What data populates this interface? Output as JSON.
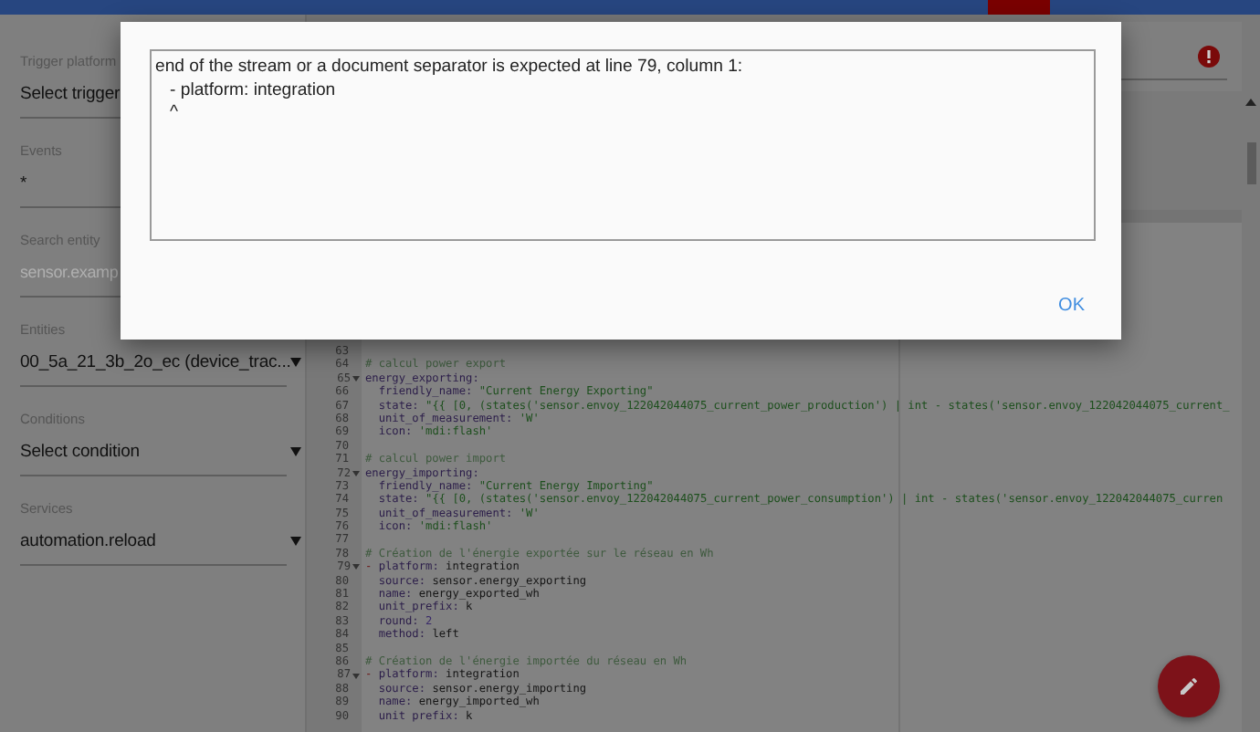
{
  "sidebar": {
    "fields": [
      {
        "label": "Trigger platform",
        "value": "Select trigger",
        "kind": "text"
      },
      {
        "label": "Events",
        "value": "*",
        "kind": "text"
      },
      {
        "label": "Search entity",
        "placeholder": "sensor.examp",
        "kind": "text"
      },
      {
        "label": "Entities",
        "value": "00_5a_21_3b_2o_ec (device_trac...",
        "kind": "dropdown"
      },
      {
        "label": "Conditions",
        "value": "Select condition",
        "kind": "dropdown"
      },
      {
        "label": "Services",
        "value": "automation.reload",
        "kind": "dropdown"
      }
    ]
  },
  "editor": {
    "lines": [
      {
        "number": "63",
        "fold": false
      },
      {
        "number": "64",
        "fold": false,
        "parts": [
          {
            "kind": "comment",
            "text": "# calcul power export"
          }
        ]
      },
      {
        "number": "65",
        "fold": true,
        "parts": [
          {
            "kind": "key",
            "text": "energy_exporting:"
          }
        ]
      },
      {
        "number": "66",
        "fold": false,
        "parts": [
          {
            "kind": "key",
            "text": "  friendly_name: "
          },
          {
            "kind": "string",
            "text": "\"Current Energy Exporting\""
          }
        ]
      },
      {
        "number": "67",
        "fold": false,
        "parts": [
          {
            "kind": "key",
            "text": "  state: "
          },
          {
            "kind": "string",
            "text": "\"{{ [0, (states('sensor.envoy_122042044075_current_power_production') | int - states('sensor.envoy_122042044075_current_"
          }
        ]
      },
      {
        "number": "68",
        "fold": false,
        "parts": [
          {
            "kind": "key",
            "text": "  unit_of_measurement: "
          },
          {
            "kind": "string",
            "text": "'W'"
          }
        ]
      },
      {
        "number": "69",
        "fold": false,
        "parts": [
          {
            "kind": "key",
            "text": "  icon: "
          },
          {
            "kind": "string",
            "text": "'mdi:flash'"
          }
        ]
      },
      {
        "number": "70",
        "fold": false
      },
      {
        "number": "71",
        "fold": false,
        "parts": [
          {
            "kind": "comment",
            "text": "# calcul power import"
          }
        ]
      },
      {
        "number": "72",
        "fold": true,
        "parts": [
          {
            "kind": "key",
            "text": "energy_importing:"
          }
        ]
      },
      {
        "number": "73",
        "fold": false,
        "parts": [
          {
            "kind": "key",
            "text": "  friendly_name: "
          },
          {
            "kind": "string",
            "text": "\"Current Energy Importing\""
          }
        ]
      },
      {
        "number": "74",
        "fold": false,
        "parts": [
          {
            "kind": "key",
            "text": "  state: "
          },
          {
            "kind": "string",
            "text": "\"{{ [0, (states('sensor.envoy_122042044075_current_power_consumption') | int - states('sensor.envoy_122042044075_curren"
          }
        ]
      },
      {
        "number": "75",
        "fold": false,
        "parts": [
          {
            "kind": "key",
            "text": "  unit_of_measurement: "
          },
          {
            "kind": "string",
            "text": "'W'"
          }
        ]
      },
      {
        "number": "76",
        "fold": false,
        "parts": [
          {
            "kind": "key",
            "text": "  icon: "
          },
          {
            "kind": "string",
            "text": "'mdi:flash'"
          }
        ]
      },
      {
        "number": "77",
        "fold": false
      },
      {
        "number": "78",
        "fold": false,
        "parts": [
          {
            "kind": "comment",
            "text": "# Création de l'énergie exportée sur le réseau en Wh"
          }
        ]
      },
      {
        "number": "79",
        "fold": true,
        "parts": [
          {
            "kind": "dash",
            "text": "- "
          },
          {
            "kind": "key",
            "text": "platform: "
          },
          {
            "kind": "plain",
            "text": "integration"
          }
        ]
      },
      {
        "number": "80",
        "fold": false,
        "parts": [
          {
            "kind": "key",
            "text": "  source: "
          },
          {
            "kind": "plain",
            "text": "sensor.energy_exporting"
          }
        ]
      },
      {
        "number": "81",
        "fold": false,
        "parts": [
          {
            "kind": "key",
            "text": "  name: "
          },
          {
            "kind": "plain",
            "text": "energy_exported_wh"
          }
        ]
      },
      {
        "number": "82",
        "fold": false,
        "parts": [
          {
            "kind": "key",
            "text": "  unit_prefix: "
          },
          {
            "kind": "plain",
            "text": "k"
          }
        ]
      },
      {
        "number": "83",
        "fold": false,
        "parts": [
          {
            "kind": "key",
            "text": "  round: "
          },
          {
            "kind": "number",
            "text": "2"
          }
        ]
      },
      {
        "number": "84",
        "fold": false,
        "parts": [
          {
            "kind": "key",
            "text": "  method: "
          },
          {
            "kind": "plain",
            "text": "left"
          }
        ]
      },
      {
        "number": "85",
        "fold": false
      },
      {
        "number": "86",
        "fold": false,
        "parts": [
          {
            "kind": "comment",
            "text": "# Création de l'énergie importée du réseau en Wh"
          }
        ]
      },
      {
        "number": "87",
        "fold": true,
        "parts": [
          {
            "kind": "dash",
            "text": "- "
          },
          {
            "kind": "key",
            "text": "platform: "
          },
          {
            "kind": "plain",
            "text": "integration"
          }
        ]
      },
      {
        "number": "88",
        "fold": false,
        "parts": [
          {
            "kind": "key",
            "text": "  source: "
          },
          {
            "kind": "plain",
            "text": "sensor.energy_importing"
          }
        ]
      },
      {
        "number": "89",
        "fold": false,
        "parts": [
          {
            "kind": "key",
            "text": "  name: "
          },
          {
            "kind": "plain",
            "text": "energy_imported_wh"
          }
        ]
      },
      {
        "number": "90",
        "fold": false,
        "parts": [
          {
            "kind": "key",
            "text": "  unit prefix: "
          },
          {
            "kind": "plain",
            "text": "k"
          }
        ]
      }
    ]
  },
  "dialog": {
    "message": "end of the stream or a document separator is expected at line 79, column 1:\n   - platform: integration\n   ^",
    "button": "OK"
  }
}
